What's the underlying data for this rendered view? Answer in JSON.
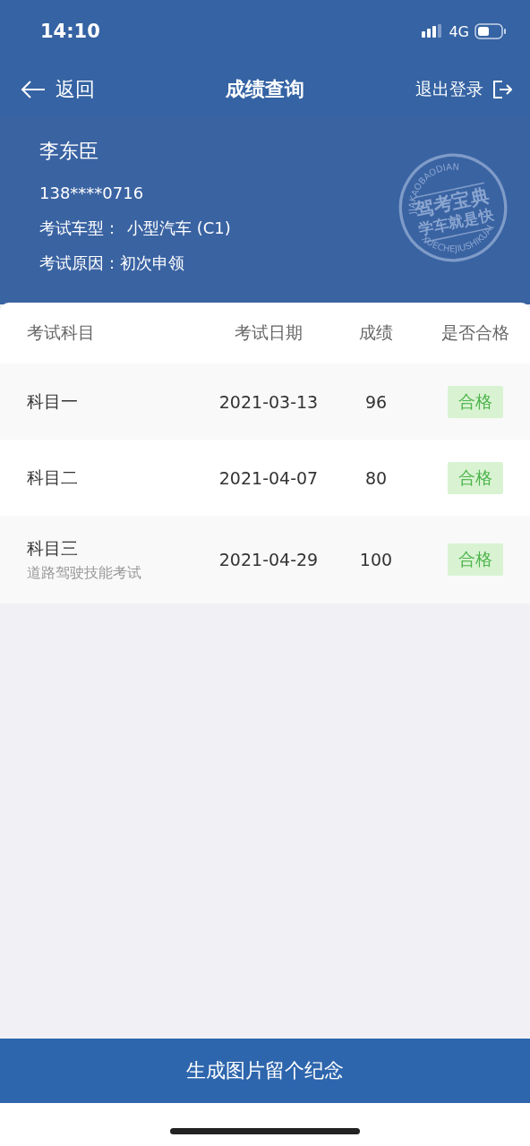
{
  "status_bar": {
    "time": "14:10",
    "network": "4G"
  },
  "nav": {
    "back": "返回",
    "title": "成绩查询",
    "logout": "退出登录"
  },
  "profile": {
    "name": "李东臣",
    "phone": "138****0716",
    "car_type_label": "考试车型：",
    "car_type": "小型汽车 (C1)",
    "reason_label": "考试原因：",
    "reason": "初次申领"
  },
  "seal": {
    "top_text": "JIAKAOBAODIAN",
    "line_1": "驾考宝典",
    "line_2": "学车就是快",
    "bottom_text": "XUECHEJIUSHIKUAI"
  },
  "table": {
    "columns": [
      "考试科目",
      "考试日期",
      "成绩",
      "是否合格"
    ],
    "rows": [
      {
        "subject": "科目一",
        "date": "2021-03-13",
        "score": "96",
        "result": "合格",
        "passed": true
      },
      {
        "subject": "科目二",
        "date": "2021-04-07",
        "score": "80",
        "result": "合格",
        "passed": true
      },
      {
        "subject": "科目三",
        "note": "道路驾驶技能考试",
        "date": "2021-04-29",
        "score": "100",
        "result": "合格",
        "passed": true
      }
    ]
  },
  "bottom_button": "生成图片留个纪念"
}
